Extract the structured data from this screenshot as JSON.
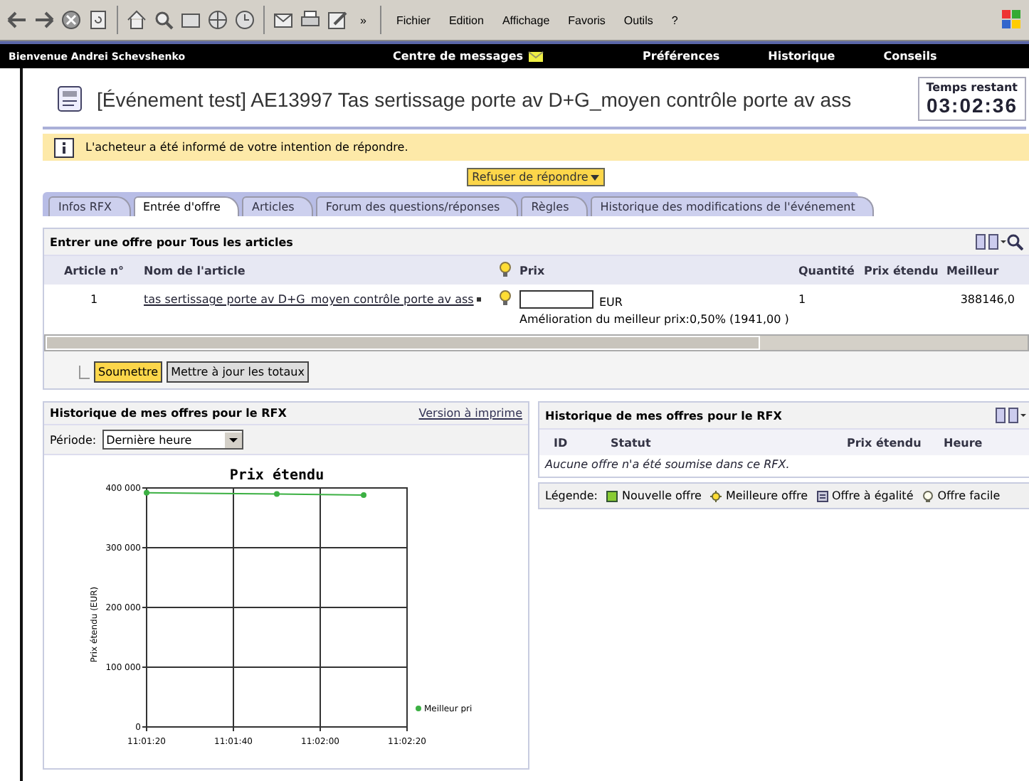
{
  "browser_toolbar": {
    "overflow": "»",
    "menu": [
      "Fichier",
      "Edition",
      "Affichage",
      "Favoris",
      "Outils",
      "?"
    ]
  },
  "nav": {
    "welcome": "Bienvenue Andrei Schevshenko",
    "links": [
      {
        "label": "Centre de messages",
        "kind": "messages"
      },
      {
        "label": "Préférences",
        "kind": "plain"
      },
      {
        "label": "Historique",
        "kind": "plain"
      },
      {
        "label": "Conseils",
        "kind": "plain"
      }
    ]
  },
  "event": {
    "title": "[Événement test] AE13997 Tas sertissage porte av D+G_moyen contrôle porte av ass",
    "timer_label": "Temps restant",
    "timer": "03:02:36"
  },
  "notice": "L'acheteur a été informé de votre intention de répondre.",
  "decline_button": "Refuser de répondre",
  "tabs": [
    {
      "label": "Infos RFX",
      "selected": false
    },
    {
      "label": "Entrée d'offre",
      "selected": true
    },
    {
      "label": "Articles",
      "selected": false
    },
    {
      "label": "Forum des questions/réponses",
      "selected": false
    },
    {
      "label": "Règles",
      "selected": false
    },
    {
      "label": "Historique des modifications de l'événement",
      "selected": false
    }
  ],
  "offer_panel": {
    "title": "Entrer une offre pour Tous les articles",
    "columns": [
      "Article n°",
      "Nom de l'article",
      "Prix",
      "Quantité",
      "Prix étendu",
      "Meilleur"
    ],
    "rows": [
      {
        "number": "1",
        "name": "tas sertissage porte av D+G_moyen contrôle porte av ass",
        "currency": "EUR",
        "improvement": "Amélioration du meilleur prix:0,50% (1941,00 )",
        "quantity": "1",
        "best": "388146,0"
      }
    ],
    "buttons": [
      "Soumettre",
      "Mettre à jour les totaux"
    ]
  },
  "history_chart": {
    "title": "Historique de mes offres pour le RFX",
    "print_link": "Version à imprime",
    "period_label": "Période:",
    "period": "Dernière heure",
    "chart_data": {
      "type": "line",
      "title": "Prix étendu",
      "ylabel": "Prix étendu (EUR)",
      "categories": [
        "11:01:20",
        null,
        "11:01:40",
        null,
        "11:02:00",
        null,
        "11:02:20"
      ],
      "ylim": [
        0,
        400000
      ],
      "grid": true,
      "yticks": [
        {
          "value": 0,
          "label": "0"
        },
        {
          "value": 100000,
          "label": "100 000"
        },
        {
          "value": 200000,
          "label": "200 000"
        },
        {
          "value": 300000,
          "label": "300 000"
        },
        {
          "value": 400000,
          "label": "400 000"
        }
      ],
      "series": [
        {
          "name": "Meilleur pri",
          "color": "#3cb043",
          "marker": "circle",
          "values": [
            392000,
            null,
            null,
            390000,
            null,
            388000,
            null
          ]
        }
      ]
    }
  },
  "history_table": {
    "title": "Historique de mes offres pour le RFX",
    "columns": [
      "ID",
      "Statut",
      "Prix étendu",
      "Heure"
    ],
    "empty": "Aucune offre n'a été soumise dans ce RFX.",
    "legend_label": "Légende:",
    "legend": [
      {
        "label": "Nouvelle offre",
        "kind": "new"
      },
      {
        "label": "Meilleure offre",
        "kind": "best"
      },
      {
        "label": "Offre à égalité",
        "kind": "tie"
      },
      {
        "label": "Offre facile",
        "kind": "easy"
      }
    ]
  }
}
